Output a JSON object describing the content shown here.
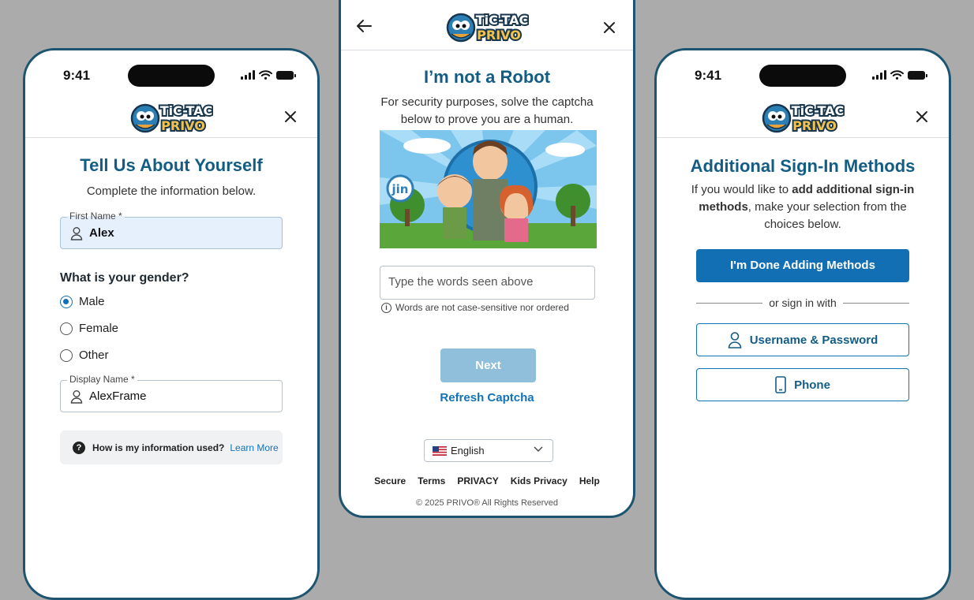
{
  "logo": {
    "line1": "TiC-TAC",
    "line2": "PRIVO"
  },
  "left": {
    "status_time": "9:41",
    "title": "Tell Us About Yourself",
    "subtitle": "Complete the information below.",
    "first_name": {
      "label": "First Name *",
      "value": "Alex"
    },
    "gender_question": "What is your gender?",
    "gender_options": [
      {
        "label": "Male",
        "selected": true
      },
      {
        "label": "Female",
        "selected": false
      },
      {
        "label": "Other",
        "selected": false
      }
    ],
    "display_name": {
      "label": "Display Name *",
      "value": "AlexFrame"
    },
    "info": {
      "text": "How is my information used?",
      "link": "Learn More"
    }
  },
  "middle": {
    "title": "I’m not a Robot",
    "subtitle": "For security purposes, solve the captcha below to prove you are a human.",
    "captcha_badge": "jin",
    "input_placeholder": "Type the words seen above",
    "hint": "Words are not case-sensitive nor ordered",
    "next_label": "Next",
    "refresh_label": "Refresh Captcha",
    "language": "English",
    "footer_links": [
      "Secure",
      "Terms",
      "PRIVACY",
      "Kids Privacy",
      "Help"
    ],
    "copyright": "© 2025 PRIVO® All Rights Reserved"
  },
  "right": {
    "status_time": "9:41",
    "title": "Additional Sign-In Methods",
    "subtitle_pre": "If you would like to ",
    "subtitle_bold": "add additional sign-in methods",
    "subtitle_post": ", make your selection from the choices below.",
    "done_label": "I'm Done Adding Methods",
    "divider_text": "or sign in with",
    "username_label": "Username & Password",
    "phone_label": "Phone"
  },
  "colors": {
    "accent": "#126fb3",
    "title": "#135d84",
    "background": "#ababab",
    "next_disabled": "#8fbfdb"
  }
}
